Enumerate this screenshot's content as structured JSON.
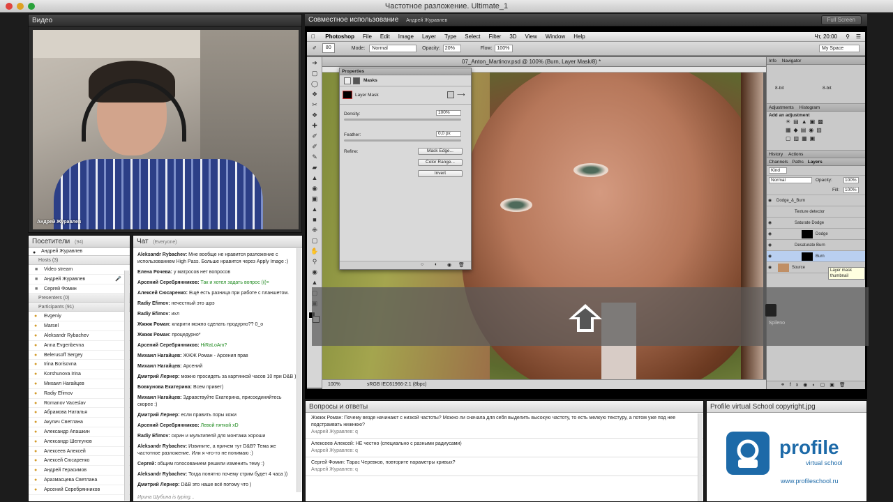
{
  "window": {
    "title": "Частотное разложение. Ultimate_1"
  },
  "video": {
    "header": "Видео",
    "presenter_name": "Андрей Журавлев"
  },
  "share": {
    "header": "Совместное использование",
    "presenter": "Андрей Журавлев",
    "fullscreen_label": "Full Screen",
    "ps_menu": [
      "Photoshop",
      "File",
      "Edit",
      "Image",
      "Layer",
      "Type",
      "Select",
      "Filter",
      "3D",
      "View",
      "Window",
      "Help"
    ],
    "ps_clock": "Чт, 20:00",
    "ps_opts": {
      "mode_label": "Mode:",
      "mode_value": "Normal",
      "opacity_label": "Opacity:",
      "opacity_value": "20%",
      "flow_label": "Flow:",
      "flow_value": "100%",
      "brush_size": "80",
      "workspace": "My Space"
    },
    "doc_tab": "07_Anton_Martinov.psd @ 100% (Burn, Layer Mask/8) *",
    "doc_zoom": "100%",
    "doc_profile": "sRGB IEC61966-2.1 (8bpc)",
    "properties": {
      "tab": "Properties",
      "section": "Masks",
      "layer_mask": "Layer Mask",
      "density_label": "Density:",
      "density_value": "100%",
      "feather_label": "Feather:",
      "feather_value": "0,0 px",
      "refine_label": "Refine:",
      "btn_mask_edge": "Mask Edge...",
      "btn_color_range": "Color Range...",
      "btn_invert": "Invert"
    },
    "right": {
      "info_tabs": [
        "Info",
        "Navigator"
      ],
      "info_bit": "8-bit",
      "adj_tabs": [
        "Adjustments",
        "Histogram"
      ],
      "add_adjustment": "Add an adjustment",
      "history_tabs": [
        "History",
        "Actions"
      ],
      "layers_tabs": [
        "Channels",
        "Paths",
        "Layers"
      ],
      "blend_mode": "Normal",
      "opacity_label": "Opacity:",
      "opacity_value": "100%",
      "fill_label": "Fill:",
      "fill_value": "100%",
      "kind_label": "Kind",
      "layers": [
        "Dodge_&_Burn",
        "Texture detector",
        "Saturate Dodge",
        "Dodge",
        "Desaturate Burn",
        "Burn",
        "Source"
      ],
      "tooltip": "Layer mask thumbnail",
      "partial_label": "Spileno"
    }
  },
  "users": {
    "header": "Посетители",
    "count": "(94)",
    "me": "Андрей Журавлев",
    "hosts_label": "Hosts (3)",
    "hosts": [
      "Video stream",
      "Андрей Журавлев",
      "Сергей Фомин"
    ],
    "presenters_label": "Presenters (0)",
    "participants_label": "Participants (91)",
    "participants": [
      "Evgeniy",
      "Marsel",
      "Aleksandr Rybachev",
      "Anna Evgenbevna",
      "Belerusoff Sergey",
      "Irina Borisovna",
      "Korshunova Irina",
      "Михаил Нагайцев",
      "Radiy Efimov",
      "Romanov Vaceslav",
      "Абрамова Наталья",
      "Акулич Светлана",
      "Александр Апашкин",
      "Александр Шелгунов",
      "Алексеев Алексей",
      "Алексей Сюсаренко",
      "Андрей Герасимов",
      "Аразмасцева Светлана",
      "Арсений Серебрянников"
    ]
  },
  "chat": {
    "header": "Чат",
    "scope": "(Everyone)",
    "messages": [
      {
        "author": "Aleksandr Rybachev:",
        "text": "Мне вообще не нравится разложение с использованием High Pass. Больше нравится через Apply Image :)",
        "green": false
      },
      {
        "author": "Елена Рочева:",
        "text": "у матросов нет вопросов",
        "green": false
      },
      {
        "author": "Арсений Серебрянников:",
        "text": "Так и хотел задать вопрос (((=",
        "green": true
      },
      {
        "author": "Алексей Сюсаренко:",
        "text": "Ещё есть разница при работе с планшетом.",
        "green": false
      },
      {
        "author": "Radiy Efimov:",
        "text": "нечестный это шрэ",
        "green": false
      },
      {
        "author": "Radiy Efimov:",
        "text": "ихл",
        "green": false
      },
      {
        "author": "Жжжж Роман:",
        "text": "кларити можно сделать продурно?? 0_о",
        "green": false
      },
      {
        "author": "Жжжж Роман:",
        "text": "процедурно*",
        "green": false
      },
      {
        "author": "Арсений Серебрянников:",
        "text": "HiRaLoAm?",
        "green": true
      },
      {
        "author": "Михаил Нагайцев:",
        "text": "ЖЖЖ Роман - Арсения прав",
        "green": false
      },
      {
        "author": "Михаил Нагайцев:",
        "text": "Арсений",
        "green": false
      },
      {
        "author": "Дмитрий Лернер:",
        "text": "можно просидеть за картинкой часов 10 при D&B )",
        "green": false
      },
      {
        "author": "Бовкунова Екатерина:",
        "text": "Всем привет)",
        "green": false
      },
      {
        "author": "Михаил Нагайцев:",
        "text": "Здравствуйте Екатерина, присоединяйтесь скорее :)",
        "green": false
      },
      {
        "author": "Дмитрий Лернер:",
        "text": "если править поры кожи",
        "green": false
      },
      {
        "author": "Арсений Серебрянников:",
        "text": "Левой пяткой хD",
        "green": true
      },
      {
        "author": "Radiy Efimov:",
        "text": "скрин и мультипелй для монтажа хороши",
        "green": false
      },
      {
        "author": "Aleksandr Rybachev:",
        "text": "Извините, а причем тут D&B? Тема же частотное разложение. Или я что-то не понимаю :)",
        "green": false
      },
      {
        "author": "Сергей:",
        "text": "общим голосованием решили изменить тему :)",
        "green": false
      },
      {
        "author": "Aleksandr Rybachev:",
        "text": "Тогда понятно почему стрим будет 4 часа ))",
        "green": false
      },
      {
        "author": "Дмитрий Лернер:",
        "text": "D&B это наше всё потому что )",
        "green": false
      }
    ],
    "typing": "Ирина Шубина is typing..."
  },
  "qa": {
    "header": "Вопросы и ответы",
    "items": [
      {
        "q": "Жжжж Роман: Почему везде начинают с низкой частоты? Можно ли сначала для себя выделить высокую частоту, то есть мелкую текстуру, а потом уже под нее подстраивать нижнюю?",
        "a": "Андрей Журавлев: q"
      },
      {
        "q": "Алексеев Алексей: НЕ честно (специально с разными радиусами)",
        "a": "Андрей Журавлев: q"
      },
      {
        "q": "Сергей Фомин: Тарас Черевков, повторите параметры кривых?",
        "a": "Андрей Журавлев: q"
      }
    ]
  },
  "logo": {
    "header": "Profile virtual School copyright.jpg",
    "brand": "profile",
    "tagline": "virtual school",
    "url": "www.profileschool.ru",
    "brand_color": "#1d6aa8"
  }
}
